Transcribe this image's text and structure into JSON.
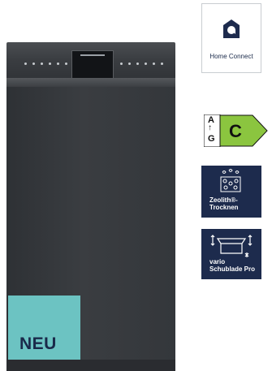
{
  "product": {
    "badge_new": "NEU"
  },
  "badges": {
    "home_connect": {
      "label": "Home Connect",
      "icon": "home-connect-icon"
    },
    "energy": {
      "scale_top": "A",
      "scale_bottom": "G",
      "class": "C",
      "arrow": "↑"
    },
    "zeolith": {
      "label_line1": "Zeolith®-",
      "label_line2": "Trocknen",
      "icon": "zeolith-icon"
    },
    "vario": {
      "label_line1": "vario",
      "label_line2": "Schublade Pro",
      "icon": "vario-drawer-icon"
    }
  },
  "colors": {
    "badge_dark": "#1d2b4d",
    "neu_bg": "#6cc3c2",
    "energy_green": "#8bc53f"
  }
}
